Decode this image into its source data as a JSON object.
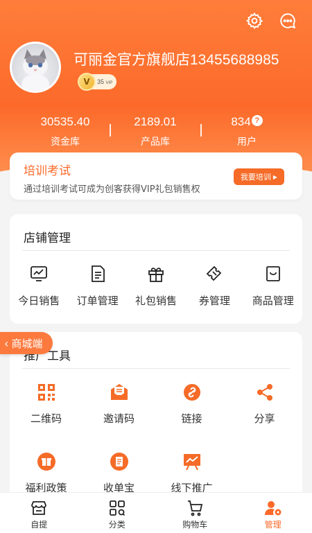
{
  "header": {
    "shop_name": "可丽金官方旗舰店13455688985",
    "vip_level": "35",
    "vip_suffix": "VIP",
    "vip_letter": "V",
    "stats": [
      {
        "value": "30535.40",
        "label": "资金库"
      },
      {
        "value": "2189.01",
        "label": "产品库"
      },
      {
        "value": "834",
        "label": "用户"
      }
    ],
    "question_mark": "?"
  },
  "training": {
    "title": "培训考试",
    "desc": "通过培训考试可成为创客获得VIP礼包销售权",
    "button": "我要培训"
  },
  "store": {
    "title": "店铺管理",
    "items": [
      {
        "label": "今日销售",
        "icon": "chart-monitor-icon"
      },
      {
        "label": "订单管理",
        "icon": "document-icon"
      },
      {
        "label": "礼包销售",
        "icon": "gift-icon"
      },
      {
        "label": "券管理",
        "icon": "ticket-icon"
      },
      {
        "label": "商品管理",
        "icon": "bag-icon"
      }
    ]
  },
  "mall_tag": "商城端",
  "promo": {
    "title": "推广工具",
    "items": [
      {
        "label": "二维码",
        "icon": "qrcode-icon"
      },
      {
        "label": "邀请码",
        "icon": "mail-icon"
      },
      {
        "label": "链接",
        "icon": "link-icon"
      },
      {
        "label": "分享",
        "icon": "share-icon"
      },
      {
        "label": "福利政策",
        "icon": "gift-box-icon"
      },
      {
        "label": "收单宝",
        "icon": "clipboard-icon"
      },
      {
        "label": "线下推广",
        "icon": "board-chart-icon"
      }
    ]
  },
  "tabbar": [
    {
      "label": "自提",
      "icon": "store-icon"
    },
    {
      "label": "分类",
      "icon": "category-icon"
    },
    {
      "label": "购物车",
      "icon": "cart-icon"
    },
    {
      "label": "管理",
      "icon": "manage-icon"
    }
  ],
  "colors": {
    "accent": "#fc6a2a",
    "header_start": "#ff7d3a",
    "header_end": "#ff9a5a"
  }
}
